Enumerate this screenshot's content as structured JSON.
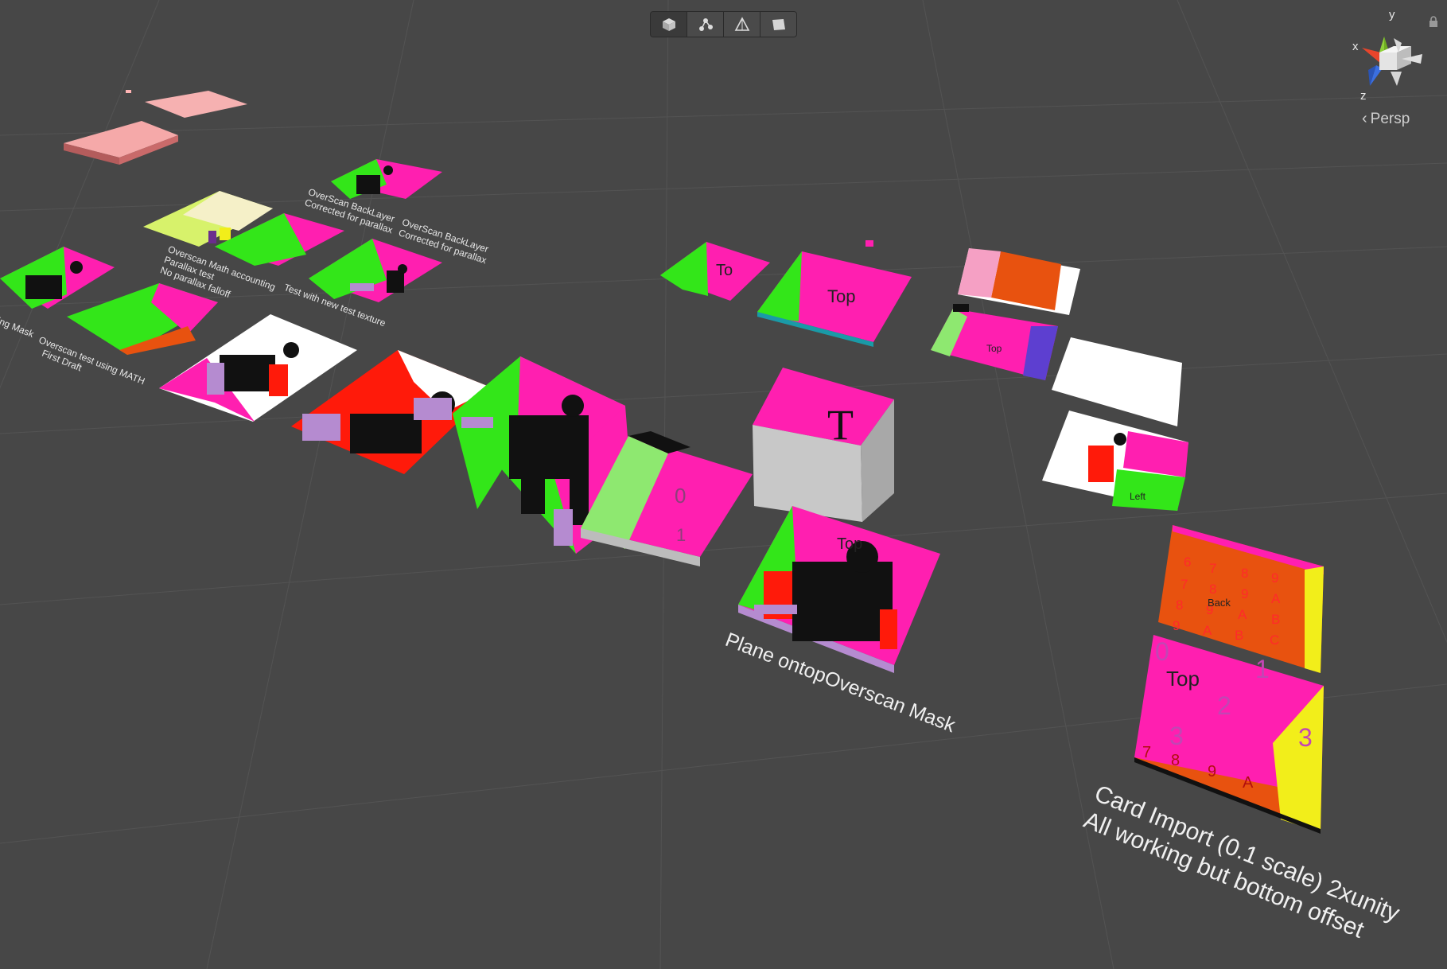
{
  "toolbar": {
    "buttons": [
      {
        "icon": "shaded-cube-icon",
        "active": true
      },
      {
        "icon": "vertex-nodes-icon",
        "active": false
      },
      {
        "icon": "wireframe-triangle-icon",
        "active": false
      },
      {
        "icon": "flag-icon",
        "active": false
      }
    ]
  },
  "gizmo": {
    "x_label": "x",
    "y_label": "y",
    "z_label": "z",
    "projection_label": "Persp",
    "colors": {
      "x": "#e8452b",
      "y": "#8fd13a",
      "z": "#3b6fe0"
    }
  },
  "scene_labels": {
    "overscan_backlayer_1": "OverScan BackLayer",
    "overscan_backlayer_1b": "Corrected for parallax",
    "overscan_backlayer_2": "OverScan BackLayer",
    "overscan_backlayer_2b": "Corrected for parallax",
    "math_accounting_1": "Overscan Math accounting",
    "math_accounting_2": "Parallax test",
    "math_accounting_3": "No parallax falloff",
    "test_new_texture": "Test with new test texture",
    "using_mask": "ing Mask",
    "overscan_test_math": "Overscan test using MATH",
    "first_draft": "First Draft",
    "plane_ontop": "Plane ontopOverscan Mask",
    "card_import_1": "Card Import (0.1 scale) 2xunity",
    "card_import_2": "All working but bottom offset"
  },
  "card_texts": {
    "top_word": "Top",
    "left_word": "Left",
    "back_word": "Back",
    "to_word": "To",
    "t_letter": "T",
    "digits": [
      "0",
      "1",
      "2",
      "3",
      "4",
      "5",
      "6",
      "7",
      "8",
      "9",
      "A",
      "B",
      "C",
      "D",
      "E"
    ]
  },
  "colors": {
    "background": "#474747",
    "magenta": "#ff1fb0",
    "green": "#33e619",
    "red": "#ff1a0a",
    "orange": "#e8520f",
    "yellow": "#f2ee1a",
    "lilac": "#b58bd0",
    "pink_slab": "#f4a6a6"
  }
}
